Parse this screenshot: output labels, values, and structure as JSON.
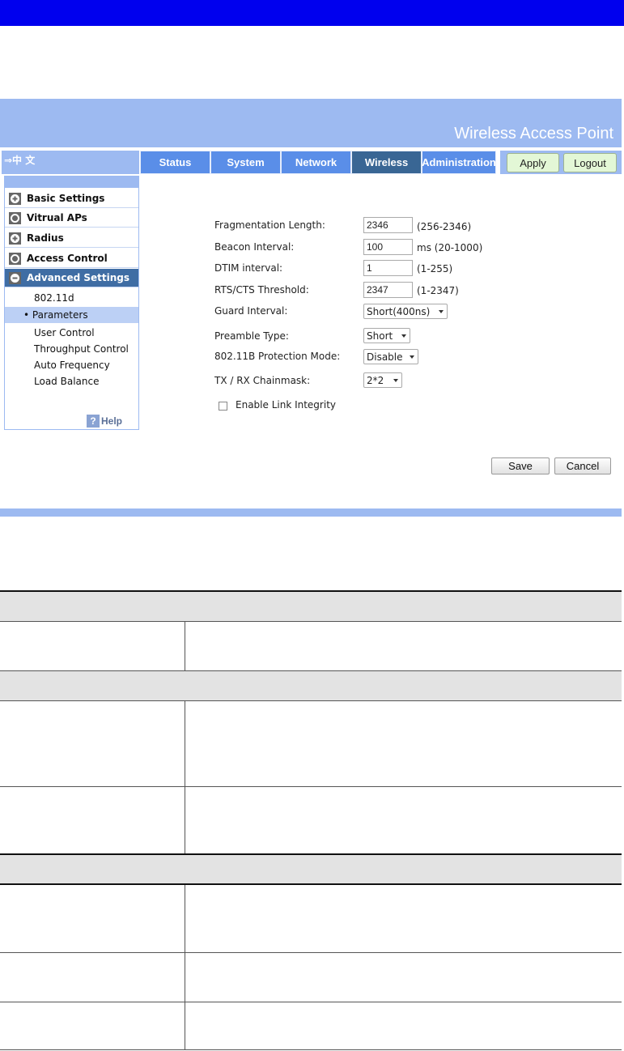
{
  "banner": {
    "title": "Wireless Access Point"
  },
  "lang": {
    "label": "⇒中 文"
  },
  "nav": {
    "tabs": [
      {
        "label": "Status",
        "active": false
      },
      {
        "label": "System",
        "active": false
      },
      {
        "label": "Network",
        "active": false
      },
      {
        "label": "Wireless",
        "active": true
      },
      {
        "label": "Administration",
        "active": false
      }
    ],
    "apply": "Apply",
    "logout": "Logout"
  },
  "sidebar": {
    "menus": [
      {
        "label": "Basic Settings",
        "icon": "plus-icon"
      },
      {
        "label": "Vitrual APs",
        "icon": "circle-icon"
      },
      {
        "label": "Radius",
        "icon": "plus-icon"
      },
      {
        "label": "Access Control",
        "icon": "circle-icon"
      },
      {
        "label": "Advanced Settings",
        "icon": "minus-icon"
      }
    ],
    "sub": [
      "802.11d",
      "• Parameters",
      "User Control",
      "Throughput Control",
      "Auto Frequency",
      "Load Balance"
    ],
    "help": "Help"
  },
  "form": {
    "frag": {
      "label": "Fragmentation Length:",
      "value": "2346",
      "range": "(256-2346)"
    },
    "beacon": {
      "label": "Beacon Interval:",
      "value": "100",
      "range": "ms (20-1000)"
    },
    "dtim": {
      "label": "DTIM interval:",
      "value": "1",
      "range": "(1-255)"
    },
    "rts": {
      "label": "RTS/CTS Threshold:",
      "value": "2347",
      "range": "(1-2347)"
    },
    "guard": {
      "label": "Guard Interval:",
      "value": "Short(400ns)"
    },
    "preamble": {
      "label": "Preamble Type:",
      "value": "Short"
    },
    "protection": {
      "label": "802.11B Protection Mode:",
      "value": "Disable"
    },
    "chainmask": {
      "label": "TX / RX Chainmask:",
      "value": "2*2"
    },
    "link": {
      "label": "Enable Link Integrity",
      "checked": false
    },
    "save": "Save",
    "cancel": "Cancel"
  }
}
